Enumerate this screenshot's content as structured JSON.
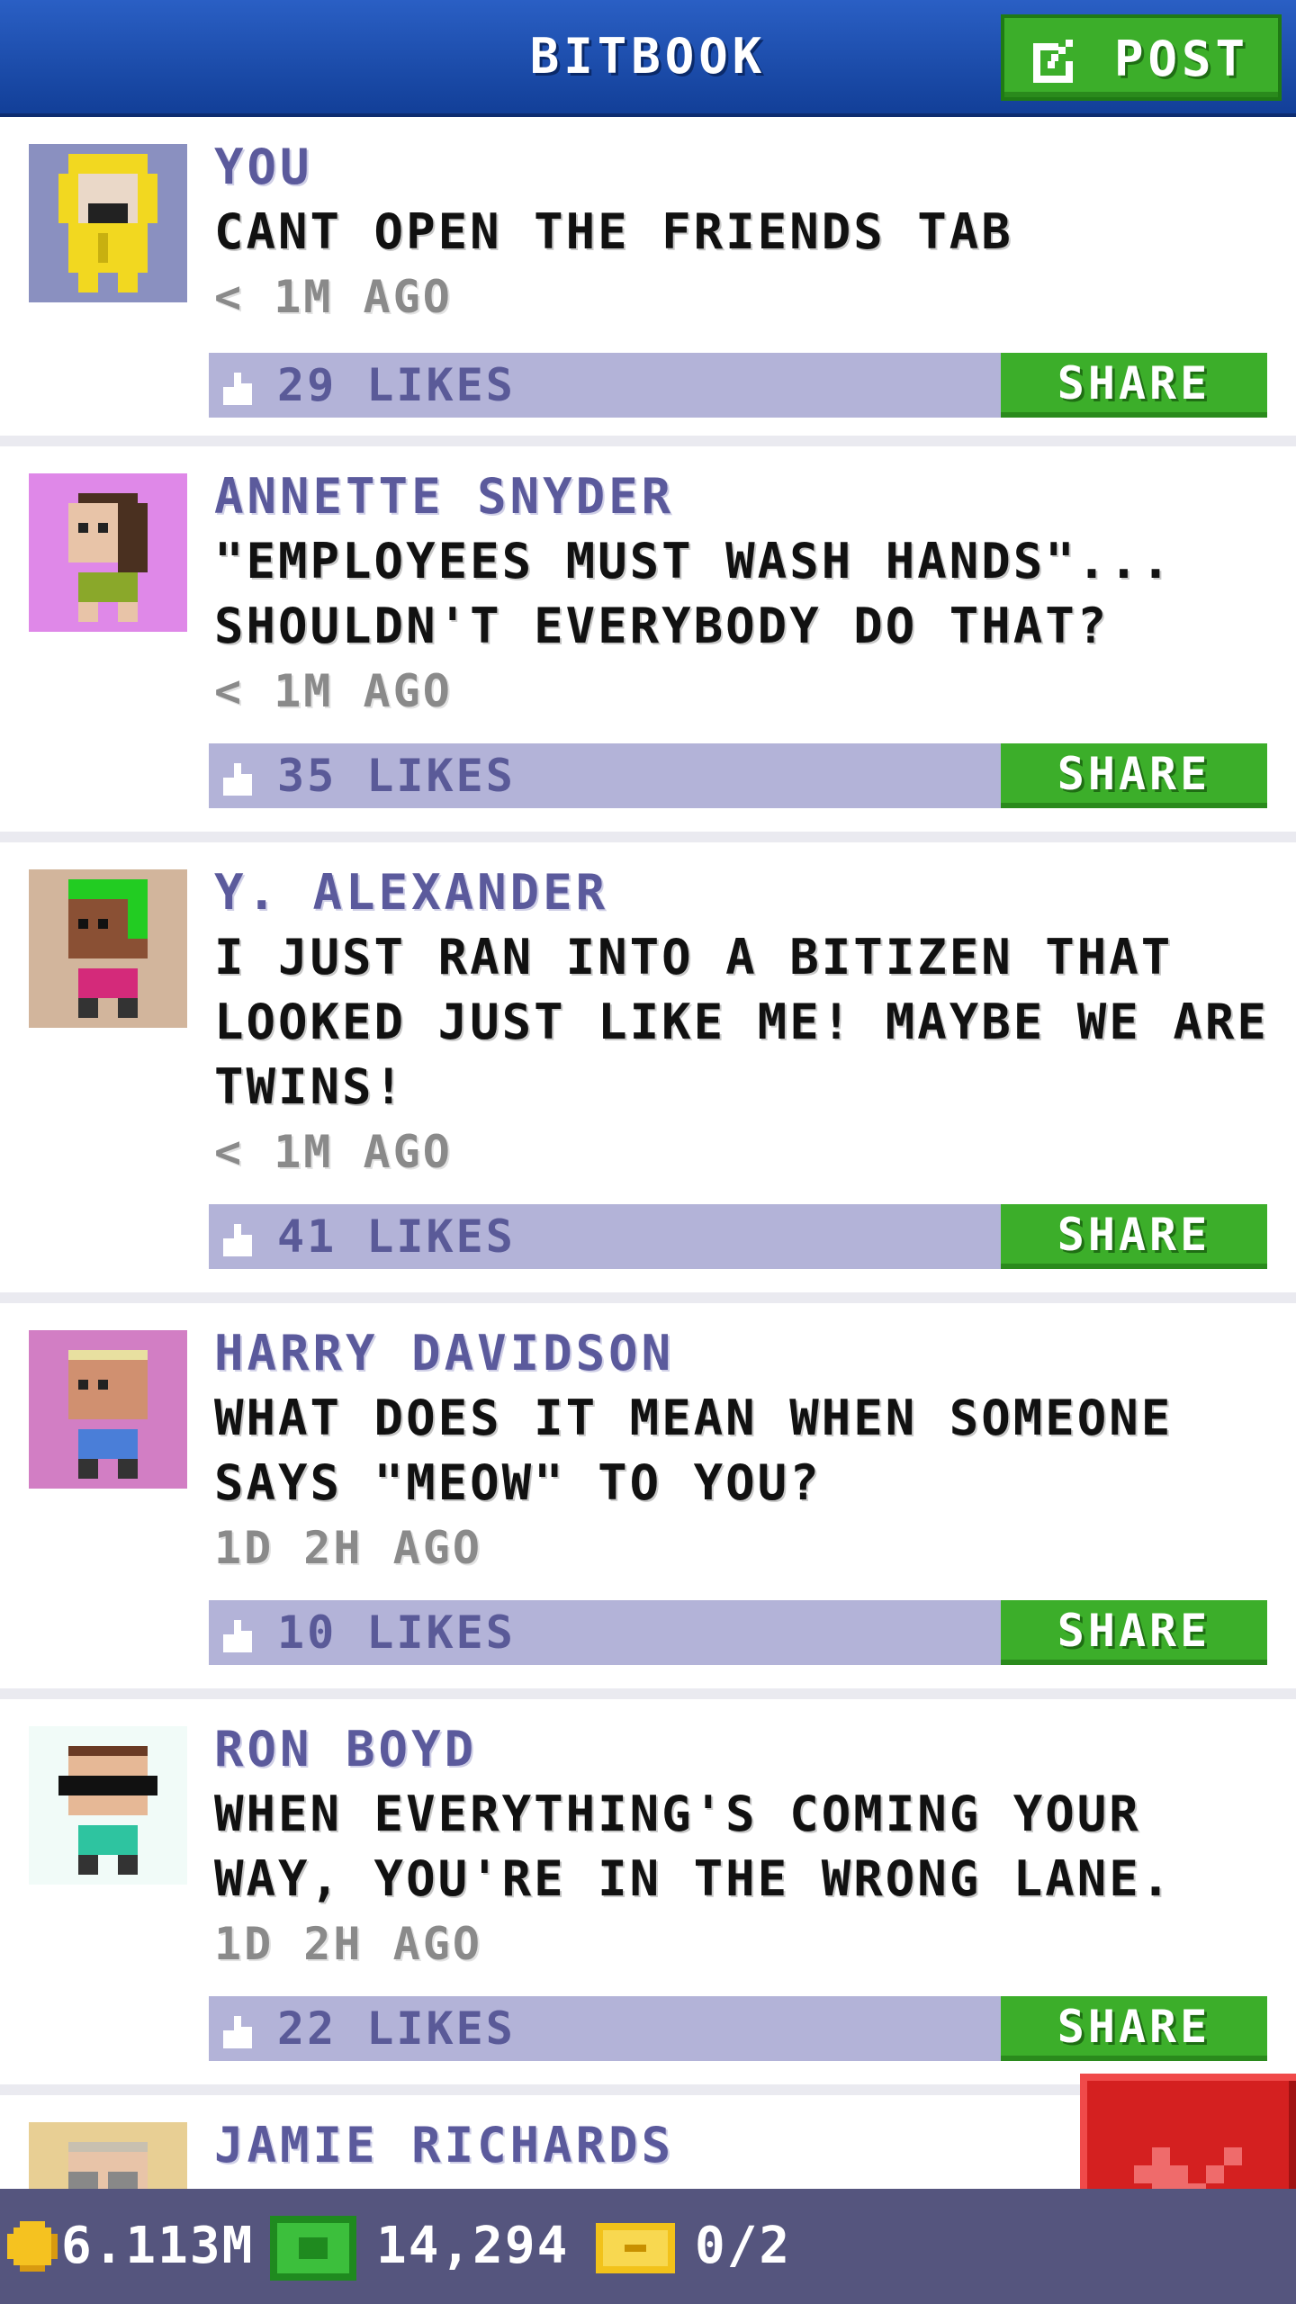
{
  "header": {
    "title": "BITBOOK",
    "post_label": "POST"
  },
  "posts": [
    {
      "author": "YOU",
      "lines": [
        "CANT OPEN THE FRIENDS TAB"
      ],
      "time": "< 1M AGO",
      "likes": "29 LIKES",
      "share": "SHARE",
      "avatar_bg": "#8a90c0"
    },
    {
      "author": "ANNETTE SNYDER",
      "lines": [
        "\"EMPLOYEES MUST WASH HANDS\"...",
        "SHOULDN'T EVERYBODY DO THAT?"
      ],
      "time": "< 1M AGO",
      "likes": "35 LIKES",
      "share": "SHARE",
      "avatar_bg": "#df88e8"
    },
    {
      "author": "Y. ALEXANDER",
      "lines": [
        "I JUST RAN INTO A BITIZEN THAT",
        "LOOKED JUST LIKE ME! MAYBE WE ARE",
        "TWINS!"
      ],
      "time": "< 1M AGO",
      "likes": "41 LIKES",
      "share": "SHARE",
      "avatar_bg": "#d2b59c"
    },
    {
      "author": "HARRY DAVIDSON",
      "lines": [
        "WHAT DOES IT MEAN WHEN SOMEONE",
        "SAYS \"MEOW\" TO YOU?"
      ],
      "time": "1D 2H AGO",
      "likes": "10 LIKES",
      "share": "SHARE",
      "avatar_bg": "#d27ec4"
    },
    {
      "author": "RON BOYD",
      "lines": [
        "WHEN EVERYTHING'S COMING YOUR",
        "WAY, YOU'RE IN THE WRONG LANE."
      ],
      "time": "1D 2H AGO",
      "likes": "22 LIKES",
      "share": "SHARE",
      "avatar_bg": "#f1fbf8"
    },
    {
      "author": "JAMIE RICHARDS",
      "lines": [],
      "time": "",
      "likes": "",
      "share": "",
      "avatar_bg": "#e8cf94"
    }
  ],
  "bottom_bar": {
    "coins": "6.113M",
    "bux": "14,294",
    "tickets": "0/2"
  },
  "colors": {
    "header": "#1d4fb0",
    "share_green": "#3cae2a",
    "likes_bar": "#b3b3d8",
    "author_text": "#5b5a9c",
    "bottom_bar": "#55557e",
    "close_red": "#d42020"
  },
  "icons": {
    "post": "edit-icon",
    "likes": "thumbs-up-icon",
    "coins": "coin-icon",
    "bux": "bux-icon",
    "tickets": "ticket-icon",
    "close": "close-icon"
  }
}
